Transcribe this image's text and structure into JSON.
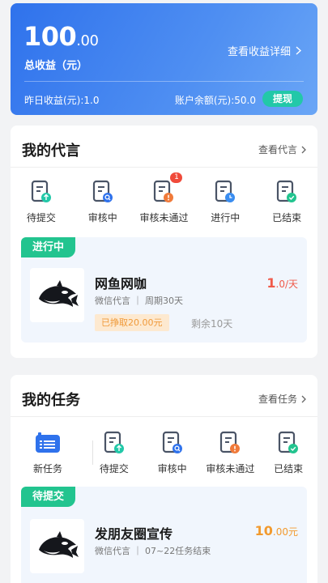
{
  "earnings": {
    "total_integer": "100",
    "total_decimal": ".00",
    "total_label": "总收益（元）",
    "detail_link": "查看收益详细",
    "yesterday": "昨日收益(元):1.0",
    "balance": "账户余额(元):50.0",
    "withdraw": "提现"
  },
  "endorse": {
    "title": "我的代言",
    "more": "查看代言",
    "tabs": [
      {
        "label": "待提交",
        "icon": "doc-upload-icon"
      },
      {
        "label": "审核中",
        "icon": "doc-search-icon"
      },
      {
        "label": "审核未通过",
        "icon": "doc-warning-icon",
        "badge": "1"
      },
      {
        "label": "进行中",
        "icon": "doc-clock-icon"
      },
      {
        "label": "已结束",
        "icon": "doc-check-icon"
      }
    ],
    "card": {
      "status": "进行中",
      "title": "网鱼网咖",
      "meta": "微信代言 ｜ 周期30天",
      "price": "1",
      "price_unit": ".0/天",
      "earned": "已挣取20.00元",
      "remaining": "剩余10天"
    }
  },
  "tasks": {
    "title": "我的任务",
    "more": "查看任务",
    "new_task": "新任务",
    "tabs": [
      {
        "label": "待提交",
        "icon": "doc-upload-icon"
      },
      {
        "label": "审核中",
        "icon": "doc-search-icon"
      },
      {
        "label": "审核未通过",
        "icon": "doc-warning-icon"
      },
      {
        "label": "已结束",
        "icon": "doc-check-icon"
      }
    ],
    "card": {
      "status": "待提交",
      "title": "发朋友圈宣传",
      "meta": "微信代言 ｜ 07~22任务结束",
      "price": "10",
      "price_unit": ".00元"
    }
  },
  "colors": {
    "brand_blue": "#2f72ec",
    "status_green": "#22c48f",
    "withdraw_green": "#22c8a8",
    "price_red": "#f05a4a",
    "price_orange": "#f29a2e",
    "badge_red": "#f04a3a"
  }
}
